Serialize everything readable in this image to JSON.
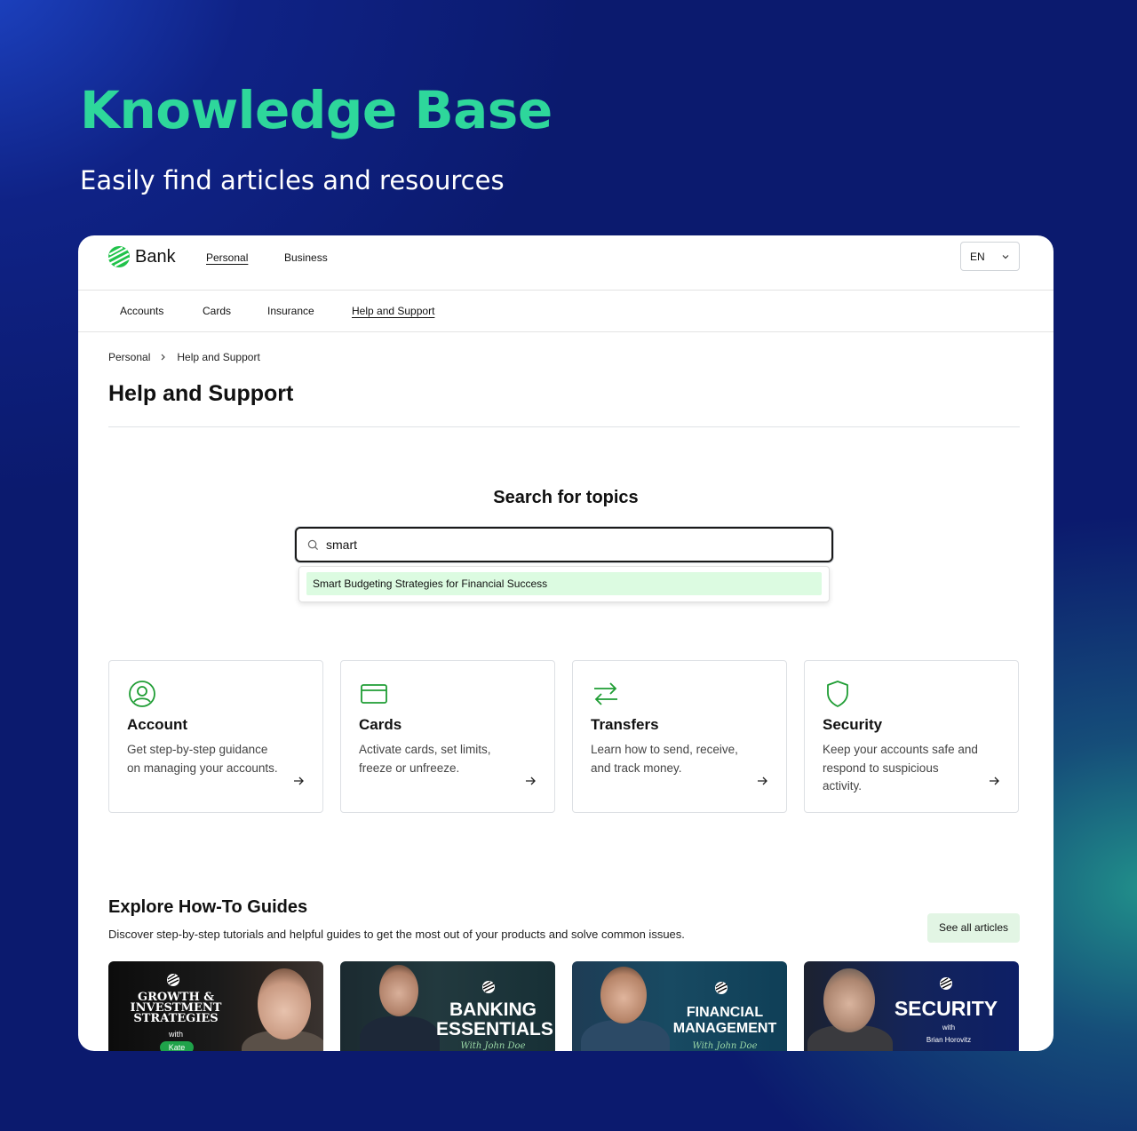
{
  "hero": {
    "title": "Knowledge Base",
    "subtitle": "Easily find articles and resources"
  },
  "brand": {
    "name": "Bank"
  },
  "topnav": {
    "personal": "Personal",
    "business": "Business"
  },
  "language": {
    "value": "EN"
  },
  "subnav": {
    "accounts": "Accounts",
    "cards": "Cards",
    "insurance": "Insurance",
    "help": "Help and Support"
  },
  "breadcrumb": {
    "root": "Personal",
    "current": "Help and Support"
  },
  "page": {
    "title": "Help and Support"
  },
  "search": {
    "heading": "Search for topics",
    "value": "smart",
    "suggestions": [
      "Smart Budgeting Strategies for Financial Success"
    ]
  },
  "categories": [
    {
      "title": "Account",
      "description": "Get step-by-step guidance on managing your accounts.",
      "icon": "user-circle-icon"
    },
    {
      "title": "Cards",
      "description": "Activate cards, set limits, freeze or unfreeze.",
      "icon": "credit-card-icon"
    },
    {
      "title": "Transfers",
      "description": "Learn how to send, receive, and track money.",
      "icon": "arrows-exchange-icon"
    },
    {
      "title": "Security",
      "description": "Keep your accounts safe and respond to suspicious activity.",
      "icon": "shield-icon"
    }
  ],
  "guides": {
    "title": "Explore How-To Guides",
    "description": "Discover step-by-step tutorials and helpful guides to get the most out of your products and solve common issues.",
    "see_all": "See all articles",
    "thumbnails": [
      {
        "line1": "GROWTH &",
        "line2": "INVESTMENT",
        "line3": "STRATEGIES",
        "with": "with",
        "host": "Kate"
      },
      {
        "line1": "BANKING",
        "line2": "ESSENTIALS",
        "host": "With John Doe"
      },
      {
        "line1": "FINANCIAL",
        "line2": "MANAGEMENT",
        "host": "With John Doe"
      },
      {
        "line1": "SECURITY",
        "with": "with",
        "host": "Brian Horovitz"
      }
    ]
  },
  "colors": {
    "accent_green": "#2ed79b",
    "icon_green": "#1f9d34",
    "background_navy": "#0b1a6e"
  }
}
